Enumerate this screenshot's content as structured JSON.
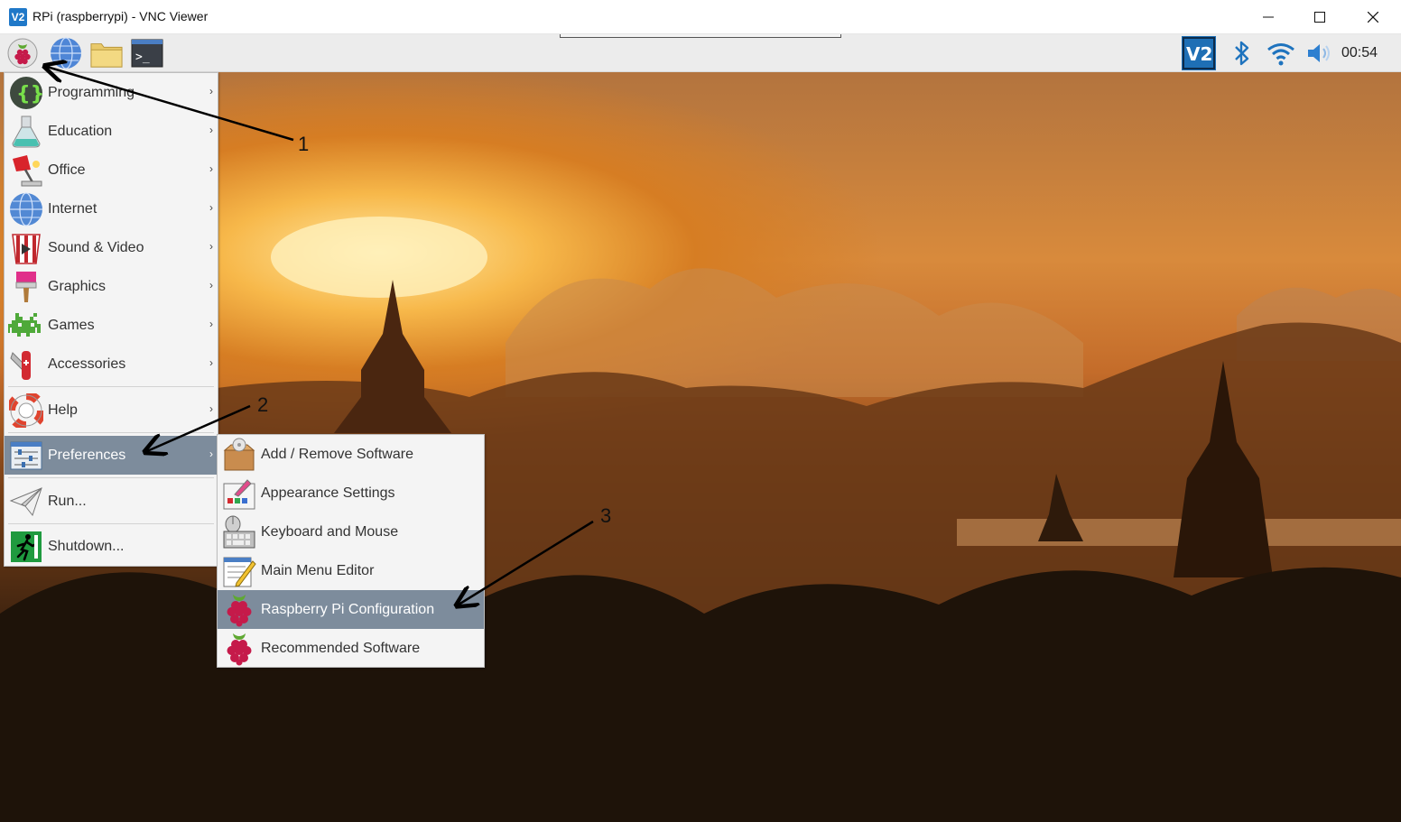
{
  "window": {
    "icon_text": "V2",
    "title": "RPi (raspberrypi) - VNC Viewer"
  },
  "panel": {
    "launchers": [
      "raspberry-menu-icon",
      "web-browser-icon",
      "file-manager-icon",
      "terminal-icon"
    ],
    "tray": [
      "vnc-server-icon",
      "bluetooth-icon",
      "wifi-icon",
      "volume-icon"
    ],
    "clock": "00:54"
  },
  "main_menu": {
    "items": [
      {
        "label": "Programming",
        "icon": "programming-icon",
        "has_submenu": true
      },
      {
        "label": "Education",
        "icon": "education-icon",
        "has_submenu": true
      },
      {
        "label": "Office",
        "icon": "office-icon",
        "has_submenu": true
      },
      {
        "label": "Internet",
        "icon": "internet-icon",
        "has_submenu": true
      },
      {
        "label": "Sound & Video",
        "icon": "sound-video-icon",
        "has_submenu": true
      },
      {
        "label": "Graphics",
        "icon": "graphics-icon",
        "has_submenu": true
      },
      {
        "label": "Games",
        "icon": "games-icon",
        "has_submenu": true
      },
      {
        "label": "Accessories",
        "icon": "accessories-icon",
        "has_submenu": true
      },
      {
        "label": "Help",
        "icon": "help-icon",
        "has_submenu": true
      },
      {
        "label": "Preferences",
        "icon": "preferences-icon",
        "has_submenu": true,
        "selected": true
      },
      {
        "label": "Run...",
        "icon": "run-icon",
        "has_submenu": false
      },
      {
        "label": "Shutdown...",
        "icon": "shutdown-icon",
        "has_submenu": false
      }
    ]
  },
  "preferences_menu": {
    "items": [
      {
        "label": "Add / Remove Software",
        "icon": "add-remove-software-icon"
      },
      {
        "label": "Appearance Settings",
        "icon": "appearance-settings-icon"
      },
      {
        "label": "Keyboard and Mouse",
        "icon": "keyboard-mouse-icon"
      },
      {
        "label": "Main Menu Editor",
        "icon": "main-menu-editor-icon"
      },
      {
        "label": "Raspberry Pi Configuration",
        "icon": "raspberry-pi-config-icon",
        "selected": true
      },
      {
        "label": "Recommended Software",
        "icon": "recommended-software-icon"
      }
    ]
  },
  "annotations": {
    "labels": [
      "1",
      "2",
      "3"
    ]
  },
  "colors": {
    "menu_highlight": "#7d8c9c",
    "panel_bg": "#ececec",
    "raspberry_red": "#c51a4a"
  }
}
